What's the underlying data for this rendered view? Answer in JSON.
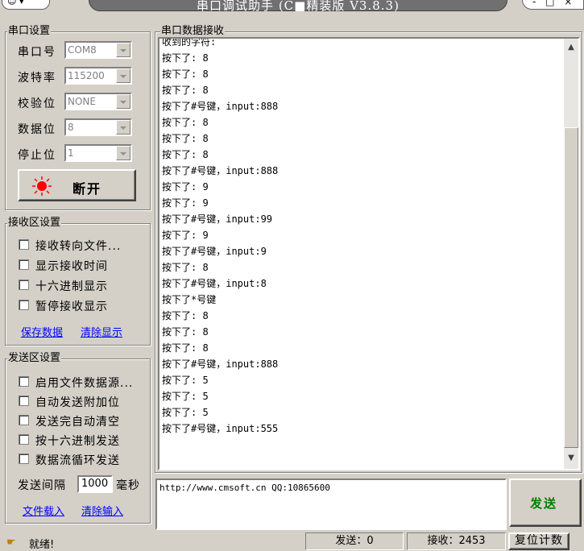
{
  "window": {
    "title": "串口调试助手 (C■精装版 V3.8.3)",
    "sys_icon": "☺ ▾",
    "controls": "- □ ×"
  },
  "serial": {
    "legend": "串口设置",
    "port_label": "串口号",
    "port_value": "COM8",
    "baud_label": "波特率",
    "baud_value": "115200",
    "parity_label": "校验位",
    "parity_value": "NONE",
    "data_label": "数据位",
    "data_value": "8",
    "stop_label": "停止位",
    "stop_value": "1",
    "open_button": "断开",
    "status_led_color": "#ff0000"
  },
  "recv_settings": {
    "legend": "接收区设置",
    "options": [
      "接收转向文件...",
      "显示接收时间",
      "十六进制显示",
      "暂停接收显示"
    ],
    "save_link": "保存数据",
    "clear_link": "清除显示"
  },
  "send_settings": {
    "legend": "发送区设置",
    "options": [
      "启用文件数据源...",
      "自动发送附加位",
      "发送完自动清空",
      "按十六进制发送",
      "数据流循环发送"
    ],
    "interval_label": "发送间隔",
    "interval_value": "1000",
    "interval_unit": "毫秒",
    "load_link": "文件载入",
    "clear_link": "清除输入"
  },
  "receive": {
    "legend": "串口数据接收",
    "lines": [
      "收到的字符:",
      "按下了: 8",
      "按下了: 8",
      "按下了: 8",
      "按下了#号键，input:888",
      "按下了: 8",
      "按下了: 8",
      "按下了: 8",
      "按下了#号键，input:888",
      "按下了: 9",
      "按下了: 9",
      "按下了#号键，input:99",
      "按下了: 9",
      "按下了#号键，input:9",
      "按下了: 8",
      "按下了#号键，input:8",
      "按下了*号键",
      "按下了: 8",
      "按下了: 8",
      "按下了: 8",
      "按下了#号键，input:888",
      "按下了: 5",
      "按下了: 5",
      "按下了: 5",
      "按下了#号键，input:555"
    ]
  },
  "send": {
    "text": "http://www.cmsoft.cn QQ:10865600",
    "button": "发送"
  },
  "status": {
    "ready": "就绪!",
    "sent": "发送：0",
    "received": "接收：2453",
    "reset": "复位计数"
  }
}
